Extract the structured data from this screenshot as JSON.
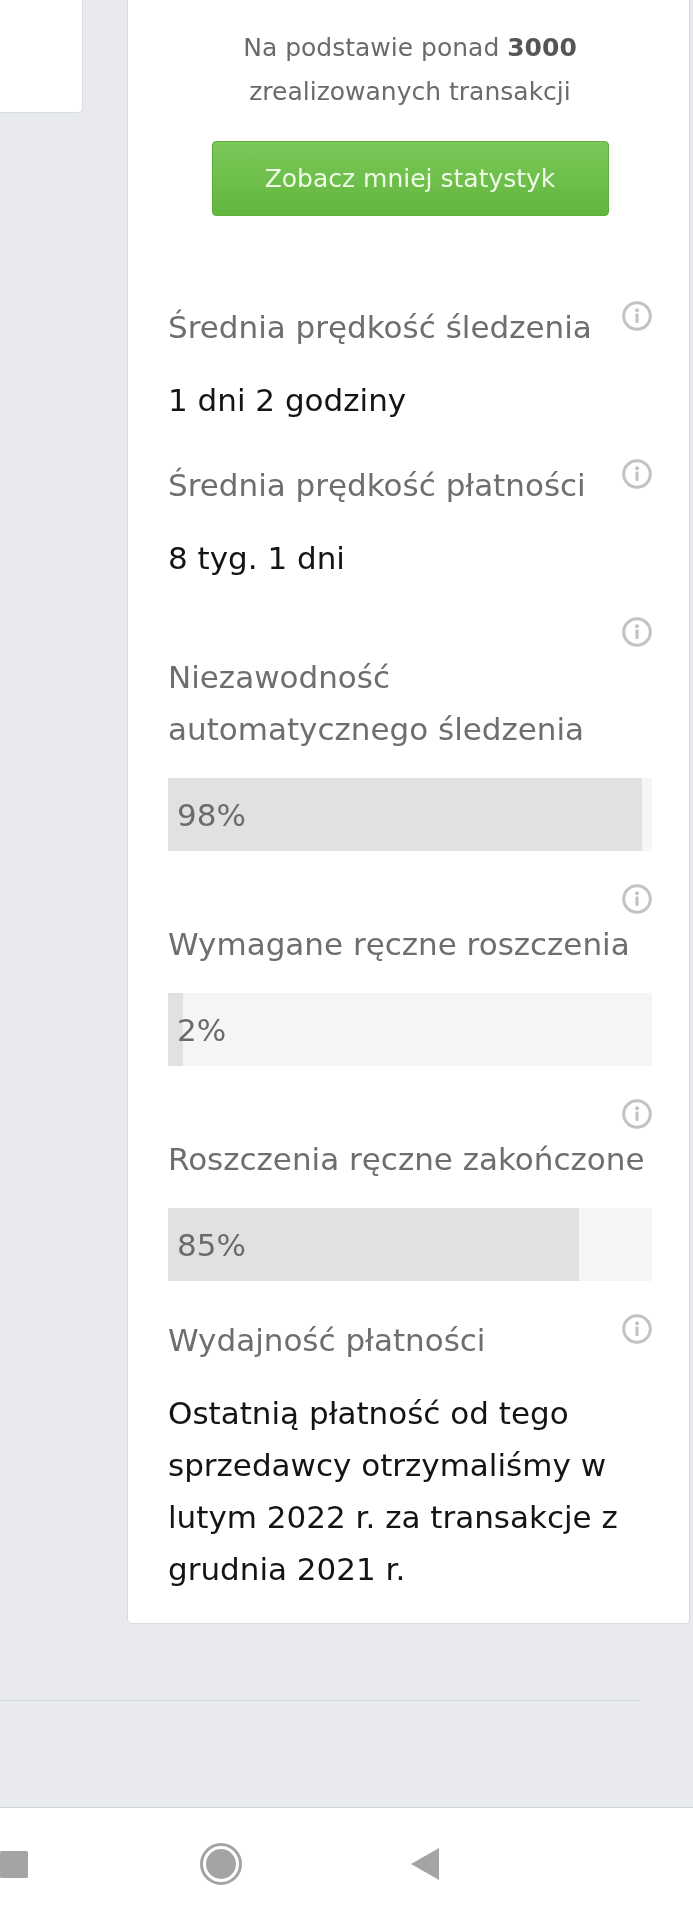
{
  "summary": {
    "text": "Na podstawie ponad **3000** zrealizowanych transakcji"
  },
  "toggle_button": {
    "label": "Zobacz mniej statystyk"
  },
  "stats": [
    {
      "kind": "text",
      "label": "Średnia prędkość śledzenia",
      "value": "1 dni 2 godziny"
    },
    {
      "kind": "text",
      "label": "Średnia prędkość płatności",
      "value": "8 tyg. 1 dni"
    },
    {
      "kind": "bar",
      "label": "Niezawodność automatycznego śledzenia",
      "level": 0.98,
      "reading": "98%"
    },
    {
      "kind": "bar",
      "label": "Wymagane ręczne roszczenia",
      "level": 0.03,
      "reading": "2%"
    },
    {
      "kind": "bar",
      "label": "Roszczenia ręczne zakończone",
      "level": 0.85,
      "reading": "85%"
    },
    {
      "kind": "text",
      "label": "Wydajność płatności",
      "value": "Ostatnią płatność od tego sprzedawcy otrzymaliśmy w lutym 2022 r. za transakcje z grudnia 2021 r."
    }
  ]
}
